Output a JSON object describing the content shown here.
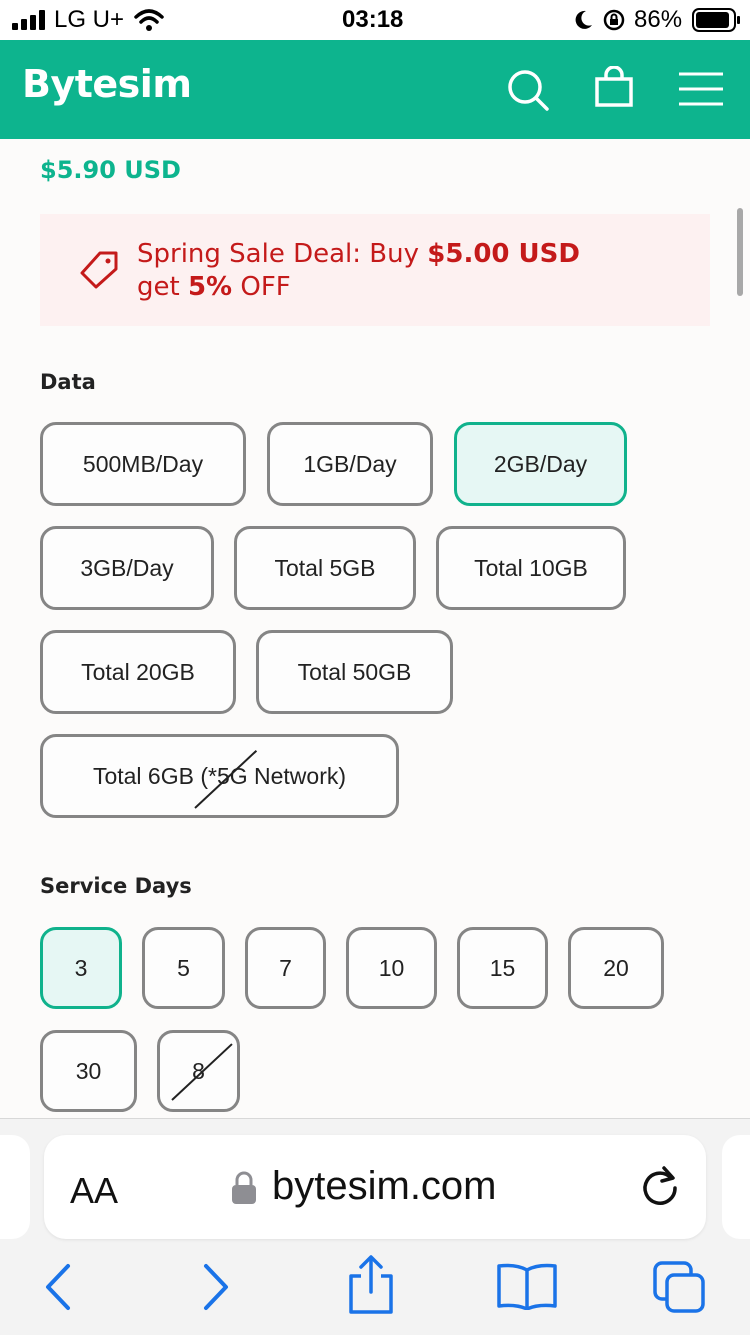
{
  "status_bar": {
    "carrier": "LG U+",
    "time": "03:18",
    "battery": "86%"
  },
  "header": {
    "logo": "Bytesim",
    "icons": [
      "search-icon",
      "bag-icon",
      "menu-icon"
    ]
  },
  "product": {
    "price": "$5.90 USD"
  },
  "promo": {
    "text_prefix": "Spring Sale Deal: Buy ",
    "amount": "$5.00 USD",
    "text_mid": "get ",
    "discount": "5%",
    "text_suffix": " OFF"
  },
  "data_section": {
    "label": "Data",
    "options": [
      {
        "label": "500MB/Day"
      },
      {
        "label": "1GB/Day"
      },
      {
        "label": "2GB/Day",
        "selected": true
      },
      {
        "label": "3GB/Day"
      },
      {
        "label": "Total 5GB"
      },
      {
        "label": "Total 10GB"
      },
      {
        "label": "Total 20GB"
      },
      {
        "label": "Total 50GB"
      },
      {
        "label": "Total 6GB (*5G Network)",
        "unavailable": true
      }
    ]
  },
  "days_section": {
    "label": "Service Days",
    "options": [
      {
        "label": "3",
        "selected": true
      },
      {
        "label": "5"
      },
      {
        "label": "7"
      },
      {
        "label": "10"
      },
      {
        "label": "15"
      },
      {
        "label": "20"
      },
      {
        "label": "30"
      },
      {
        "label": "8",
        "unavailable": true
      }
    ]
  },
  "browser": {
    "text_size_label": "AA",
    "url": "bytesim.com"
  },
  "colors": {
    "brand": "#0db48e",
    "promo_red": "#c41a1a",
    "ios_blue": "#1a73e8"
  }
}
